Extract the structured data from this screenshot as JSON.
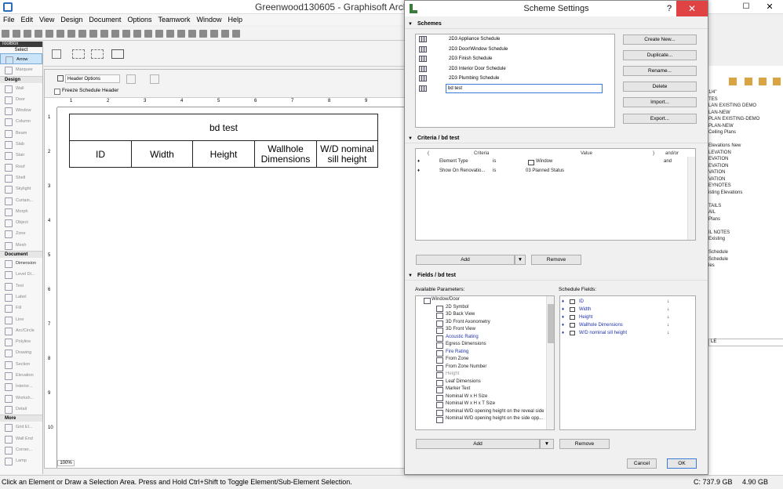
{
  "app": {
    "window_title": "Greenwood130605 - Graphisoft ArchiCAD",
    "menus": [
      "File",
      "Edit",
      "View",
      "Design",
      "Document",
      "Options",
      "Teamwork",
      "Window",
      "Help"
    ]
  },
  "toolbox": {
    "title": "ToolBox",
    "select_label": "Select",
    "select_tools": [
      "Arrow",
      "Marquee"
    ],
    "design_label": "Design",
    "design_tools": [
      "Wall",
      "Door",
      "Window",
      "Column",
      "Beam",
      "Slab",
      "Stair",
      "Roof",
      "Shell",
      "Skylight",
      "Curtain...",
      "Morph",
      "Object",
      "Zone",
      "Mesh"
    ],
    "document_label": "Document",
    "document_tools": [
      "Dimension",
      "Level Di...",
      "Text",
      "Label",
      "Fill",
      "Line",
      "Arc/Circle",
      "Polyline",
      "Drawing",
      "Section",
      "Elevation",
      "Interior...",
      "Worksh...",
      "Detail"
    ],
    "more_label": "More",
    "more_tools": [
      "Grid El...",
      "Wall End",
      "Corner...",
      "Lamp"
    ]
  },
  "schedule": {
    "header_options_label": "Header Options",
    "freeze_label": "Freeze Schedule Header",
    "title": "bd test",
    "columns": [
      "ID",
      "Width",
      "Height",
      "Wallhole Dimensions",
      "W/D nominal sill height"
    ],
    "zoom": "100%",
    "ruler_ticks": [
      "1",
      "2",
      "3",
      "4",
      "5",
      "6",
      "7",
      "8",
      "9"
    ],
    "vruler_ticks": [
      "1",
      "2",
      "3",
      "4",
      "5",
      "6",
      "7",
      "8",
      "9",
      "10"
    ]
  },
  "status": {
    "message": "Click an Element or Draw a Selection Area. Press and Hold Ctrl+Shift to Toggle Element/Sub-Element Selection.",
    "disk": "C: 737.9 GB",
    "memory": "4.90 GB"
  },
  "right_panel": {
    "lines": [
      "1/4\"",
      "TES",
      "LAN EXISTING DEMO",
      "LAN-NEW",
      "PLAN EXISTING-DEMO",
      "PLAN-NEW",
      "Ceiling Plans",
      "",
      "Elevations New",
      "LEVATION",
      "EVATION",
      "EVATION",
      "VATION",
      "VATION",
      "EYNOTES",
      "isting Elevations",
      "",
      "TAILS",
      "AIL",
      "Plans",
      "",
      "IL NOTES",
      "Existing",
      "",
      "Schedule",
      "Schedule",
      "les"
    ],
    "field_value": "LE"
  },
  "dialog": {
    "title": "Scheme Settings",
    "help": "?",
    "close": "✕",
    "schemes_header": "Schemes",
    "schemes": [
      "2D3 Appliance Schedule",
      "2D3 Door/Window Schedule",
      "2D3 Finish Schedule",
      "2D3 Interior Door Schedule",
      "2D3 Plumbing Schedule",
      "bd test"
    ],
    "buttons": {
      "create_new": "Create New...",
      "duplicate": "Duplicate...",
      "rename": "Rename...",
      "delete": "Delete",
      "import": "Import...",
      "export": "Export..."
    },
    "criteria_header": "Criteria / bd test",
    "criteria_columns": [
      "(",
      "Criteria",
      ")",
      "Value",
      ")",
      "and/or"
    ],
    "criteria_rows": [
      {
        "criteria": "Element Type",
        "op": "is",
        "value": "Window",
        "andor": "and"
      },
      {
        "criteria": "Show On Renovatio...",
        "op": "is",
        "value": "03 Planned Status",
        "andor": ""
      }
    ],
    "criteria_add": "Add",
    "criteria_remove": "Remove",
    "fields_header": "Fields / bd test",
    "available_label": "Available Parameters:",
    "schedule_fields_label": "Schedule Fields:",
    "available_root": "Window/Door",
    "available_params": [
      {
        "name": "2D Symbol",
        "style": "normal"
      },
      {
        "name": "3D Back View",
        "style": "normal"
      },
      {
        "name": "3D Front Axonometry",
        "style": "normal"
      },
      {
        "name": "3D Front View",
        "style": "normal"
      },
      {
        "name": "Acoustic Rating",
        "style": "blue"
      },
      {
        "name": "Egress Dimensions",
        "style": "normal"
      },
      {
        "name": "Fire Rating",
        "style": "blue"
      },
      {
        "name": "From Zone",
        "style": "normal"
      },
      {
        "name": "From Zone Number",
        "style": "normal"
      },
      {
        "name": "Height",
        "style": "gray"
      },
      {
        "name": "Leaf Dimensions",
        "style": "normal"
      },
      {
        "name": "Marker Text",
        "style": "normal"
      },
      {
        "name": "Nominal W x H Size",
        "style": "normal"
      },
      {
        "name": "Nominal W x H x T Size",
        "style": "normal"
      },
      {
        "name": "Nominal W/D opening height on the reveal side",
        "style": "normal"
      },
      {
        "name": "Nominal W/D opening height on the side opp...",
        "style": "normal"
      }
    ],
    "schedule_fields": [
      "ID",
      "Width",
      "Height",
      "Wallhole Dimensions",
      "W/D nominal sill height"
    ],
    "fields_add": "Add",
    "fields_remove": "Remove",
    "cancel": "Cancel",
    "ok": "OK"
  }
}
